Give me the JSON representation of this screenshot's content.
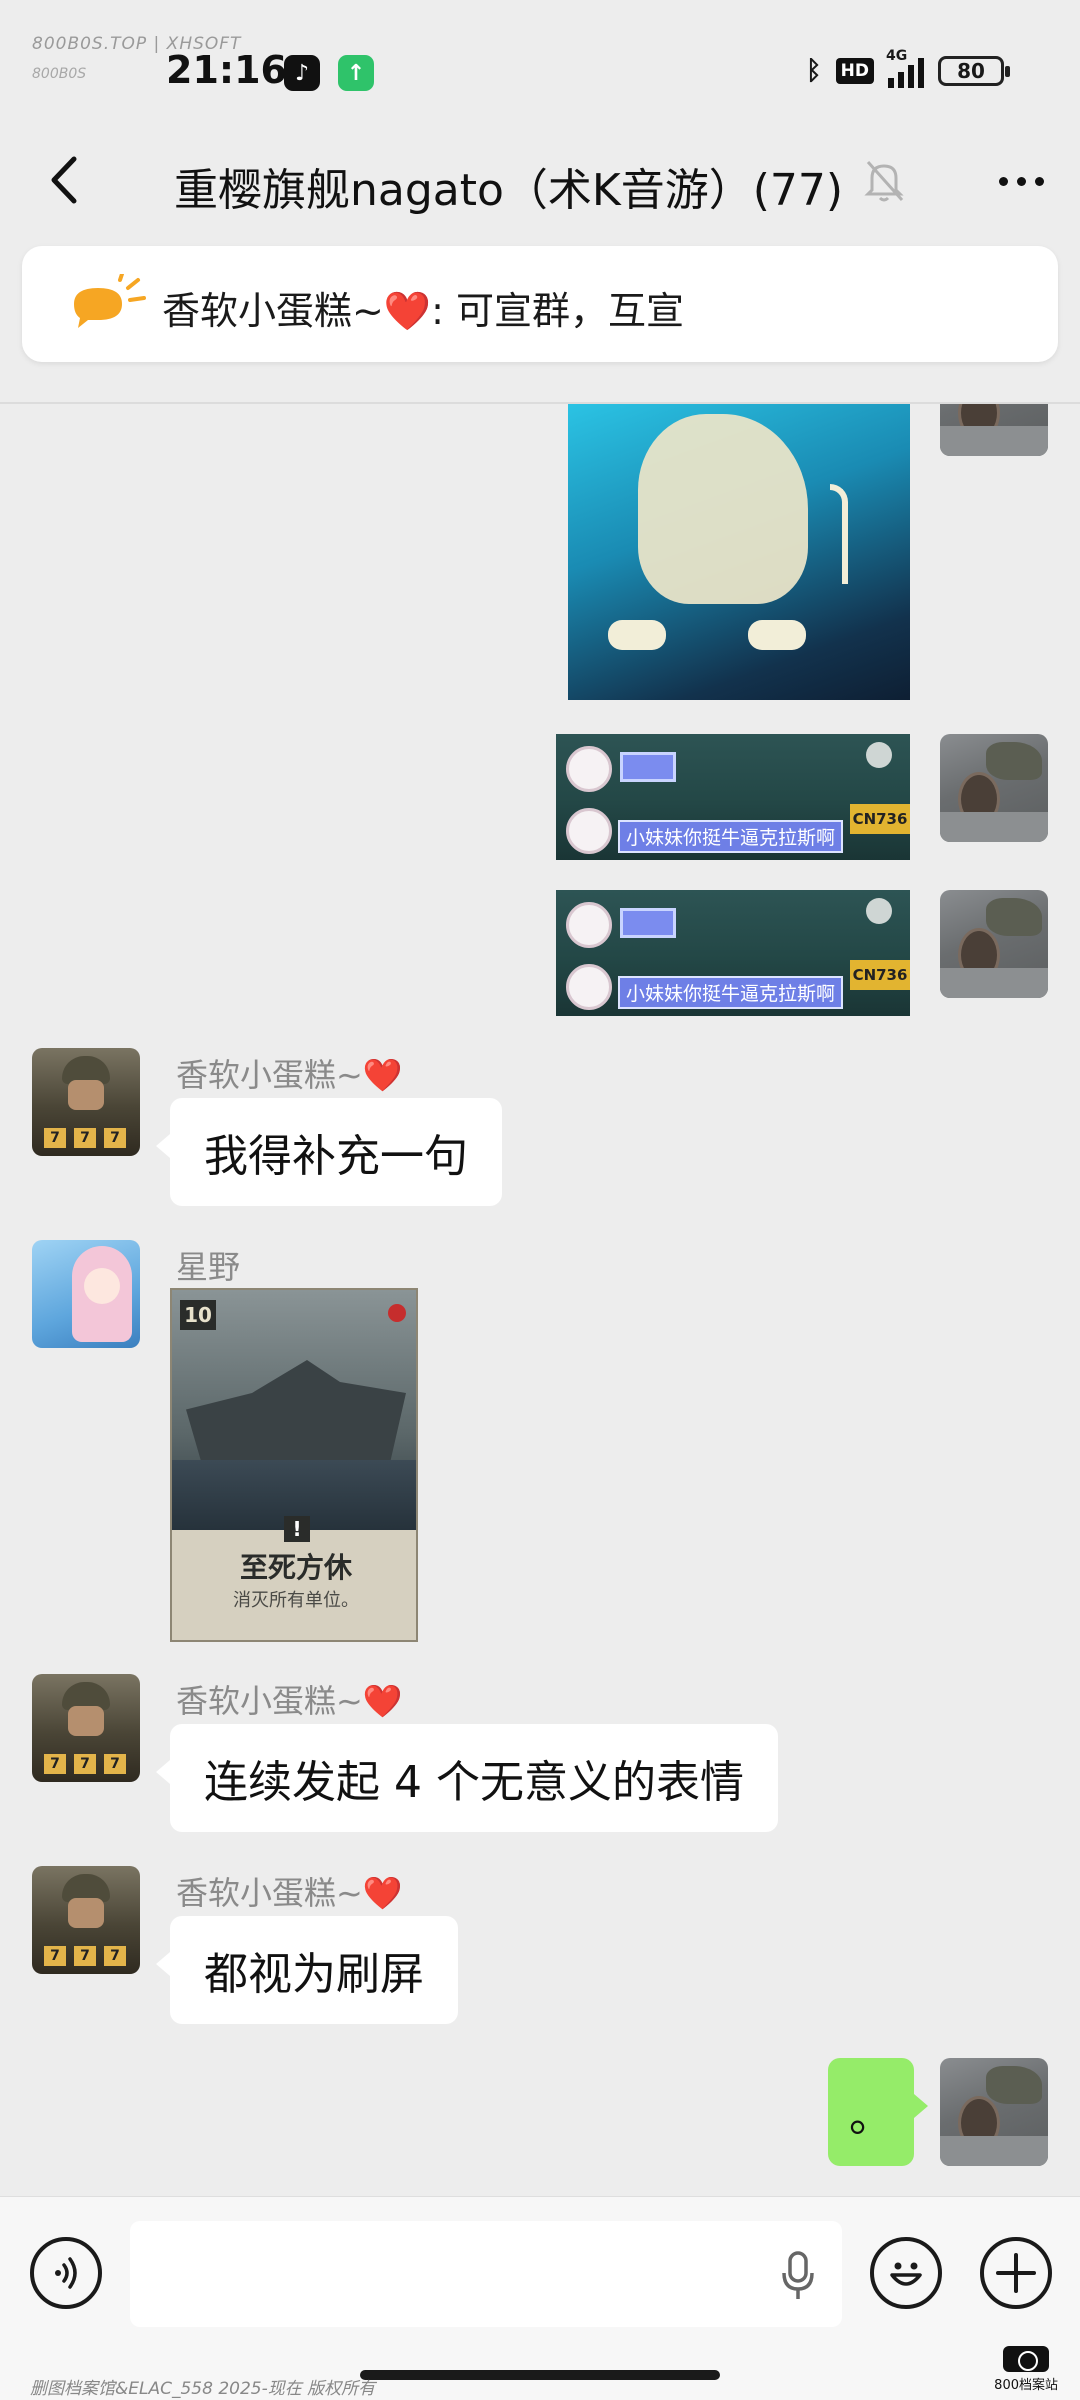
{
  "watermark": {
    "top_line1": "800B0S.TOP | XHSOFT",
    "top_line2": "800B0S",
    "bottom": "删图档案馆&ELAC_558 2025-现在 版权所有",
    "logo": "800档案站"
  },
  "status_bar": {
    "time": "21:16",
    "network": "4G",
    "hd": "HD",
    "battery": "80"
  },
  "header": {
    "title": "重樱旗舰nagato（术K音游）(77)"
  },
  "announcement": {
    "text": "香软小蛋糕~❤️: 可宣群，互宣"
  },
  "messages": [
    {
      "from": "me",
      "type": "sticker"
    },
    {
      "from": "me",
      "type": "sticker",
      "caption": "小妹妹你挺牛逼克拉斯啊",
      "plate": "CN736"
    },
    {
      "from": "me",
      "type": "sticker",
      "caption": "小妹妹你挺牛逼克拉斯啊",
      "plate": "CN736"
    },
    {
      "from": "香软小蛋糕~❤️",
      "type": "text",
      "text": "我得补充一句"
    },
    {
      "from": "星野",
      "type": "card",
      "level": "10",
      "card_title": "至死方休",
      "card_desc": "消灭所有单位。"
    },
    {
      "from": "香软小蛋糕~❤️",
      "type": "text",
      "text": "连续发起 4 个无意义的表情"
    },
    {
      "from": "香软小蛋糕~❤️",
      "type": "text",
      "text": "都视为刷屏"
    },
    {
      "from": "me",
      "type": "text",
      "text": "。"
    }
  ],
  "soldier_badges": [
    "7",
    "7",
    "7"
  ],
  "colors": {
    "background": "#ededed",
    "my_bubble": "#95ec69",
    "other_bubble": "#ffffff",
    "heart": "#e02b3a"
  }
}
